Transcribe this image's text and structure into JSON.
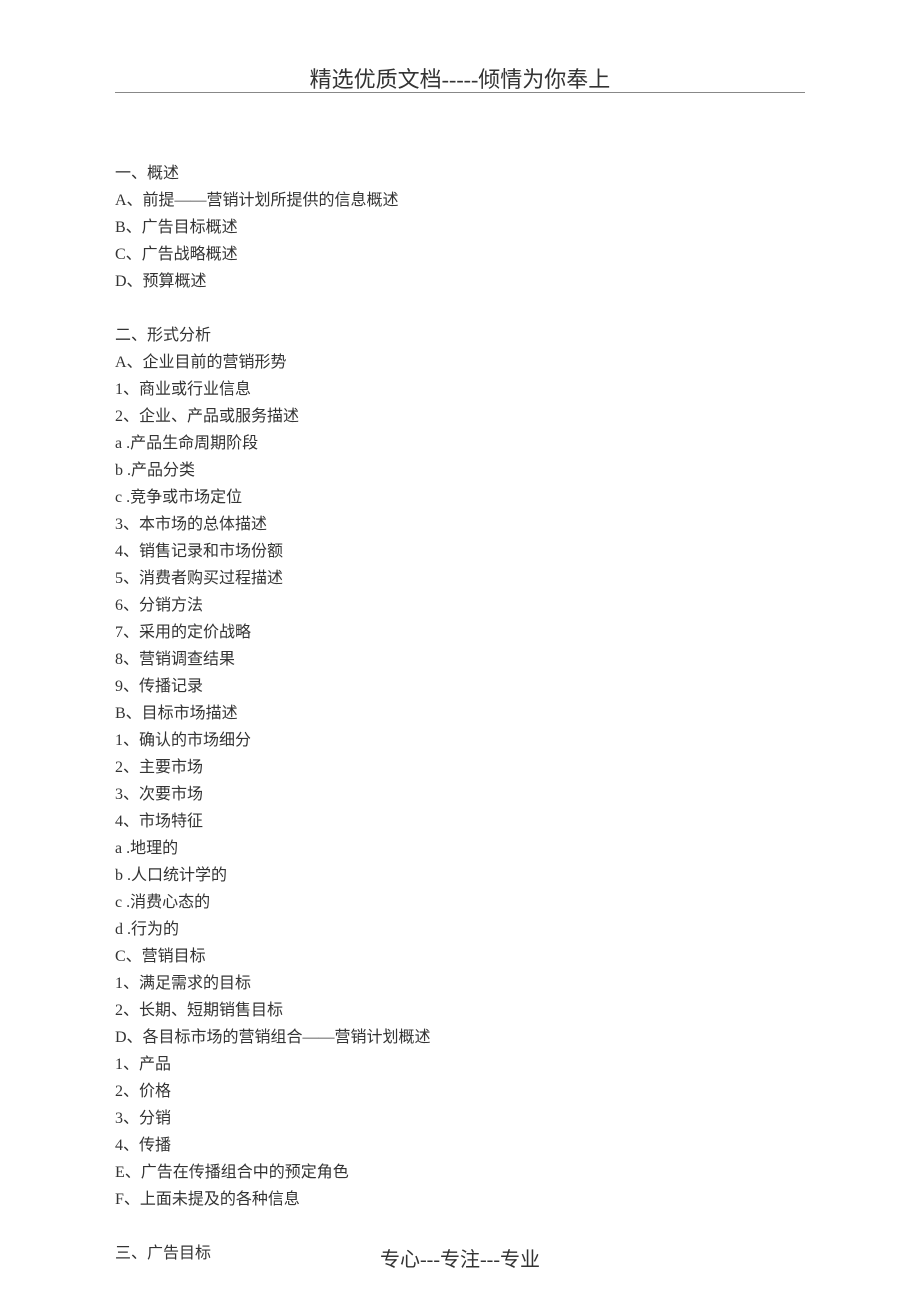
{
  "header": "精选优质文档-----倾情为你奉上",
  "footer": "专心---专注---专业",
  "sections": {
    "s1": {
      "title": "一、概述",
      "items": {
        "a": "A、前提——营销计划所提供的信息概述",
        "b": "B、广告目标概述",
        "c": "C、广告战略概述",
        "d": "D、预算概述"
      }
    },
    "s2": {
      "title": "二、形式分析",
      "partA": {
        "title": "A、企业目前的营销形势",
        "i1": "1、商业或行业信息",
        "i2": "2、企业、产品或服务描述",
        "i2a": "a .产品生命周期阶段",
        "i2b": "b .产品分类",
        "i2c": "c .竞争或市场定位",
        "i3": "3、本市场的总体描述",
        "i4": "4、销售记录和市场份额",
        "i5": "5、消费者购买过程描述",
        "i6": "6、分销方法",
        "i7": "7、采用的定价战略",
        "i8": "8、营销调查结果",
        "i9": "9、传播记录"
      },
      "partB": {
        "title": "B、目标市场描述",
        "i1": "1、确认的市场细分",
        "i2": "2、主要市场",
        "i3": "3、次要市场",
        "i4": "4、市场特征",
        "i4a": "a .地理的",
        "i4b": "b .人口统计学的",
        "i4c": "c .消费心态的",
        "i4d": "d .行为的"
      },
      "partC": {
        "title": "C、营销目标",
        "i1": "1、满足需求的目标",
        "i2": "2、长期、短期销售目标"
      },
      "partD": {
        "title": "D、各目标市场的营销组合——营销计划概述",
        "i1": "1、产品",
        "i2": "2、价格",
        "i3": "3、分销",
        "i4": "4、传播"
      },
      "partE": "E、广告在传播组合中的预定角色",
      "partF": "F、上面未提及的各种信息"
    },
    "s3": {
      "title": "三、广告目标"
    }
  }
}
